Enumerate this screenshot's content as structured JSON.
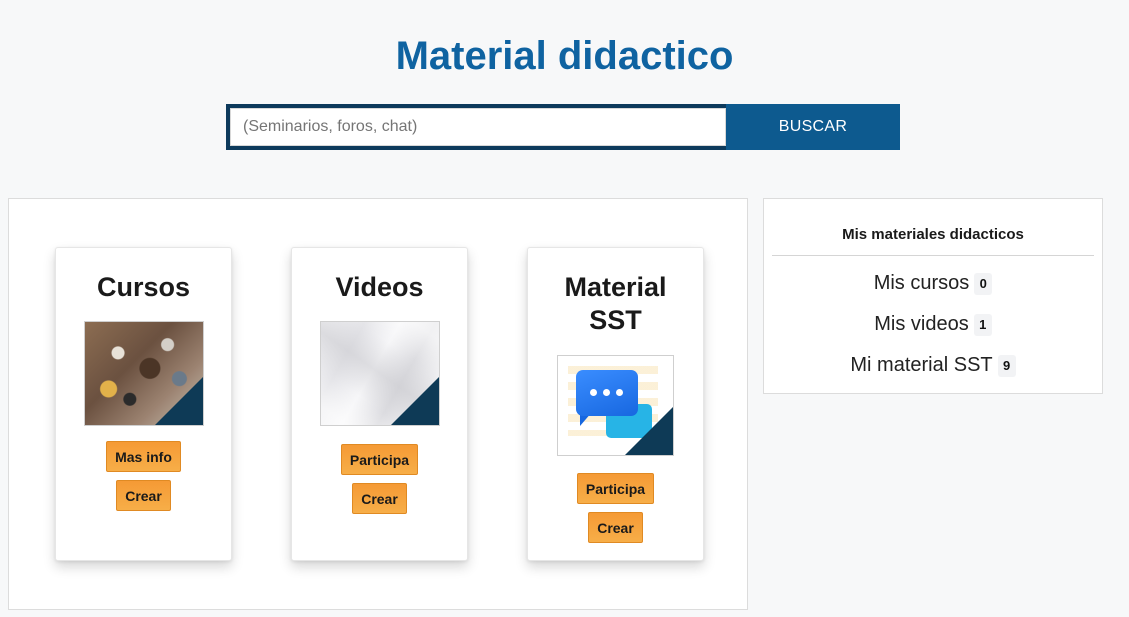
{
  "page": {
    "title": "Material didactico"
  },
  "search": {
    "placeholder": "(Seminarios, foros, chat)",
    "value": "",
    "button_label": "BUSCAR"
  },
  "cards": [
    {
      "title": "Cursos",
      "image": "team-meeting-photo",
      "buttons": [
        "Mas info",
        "Crear"
      ]
    },
    {
      "title": "Videos",
      "image": "crumpled-paper-texture",
      "buttons": [
        "Participa",
        "Crear"
      ]
    },
    {
      "title": "Material SST",
      "image": "chat-bubbles-icon",
      "buttons": [
        "Participa",
        "Crear"
      ]
    }
  ],
  "sidebar": {
    "title": "Mis materiales didacticos",
    "items": [
      {
        "label": "Mis cursos",
        "count": "0"
      },
      {
        "label": "Mis videos",
        "count": "1"
      },
      {
        "label": "Mi material SST",
        "count": "9"
      }
    ]
  },
  "colors": {
    "title": "#0f63a1",
    "search_frame": "#0d3a5c",
    "search_button": "#0d5a8f",
    "action_button": "#f59a35",
    "image_corner": "#0e3a56"
  }
}
